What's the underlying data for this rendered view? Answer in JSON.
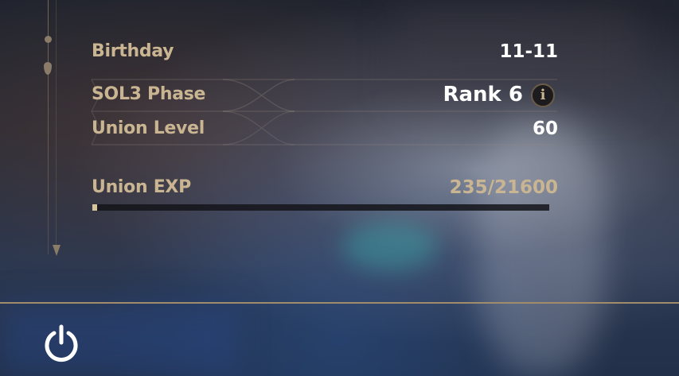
{
  "profile": {
    "rows": [
      {
        "label": "Birthday",
        "value": "11-11"
      },
      {
        "label": "SOL3 Phase",
        "value": "Rank 6"
      },
      {
        "label": "Union Level",
        "value": "60"
      }
    ],
    "union_exp": {
      "label": "Union EXP",
      "value": "235/21600",
      "current": 235,
      "max": 21600
    },
    "info_icon_glyph": "i"
  },
  "icons": {
    "info": "info-icon",
    "power": "power-icon"
  },
  "colors": {
    "label_gold": "#c9b591",
    "value_white": "#ffffff",
    "divider": "#a08c6a"
  }
}
